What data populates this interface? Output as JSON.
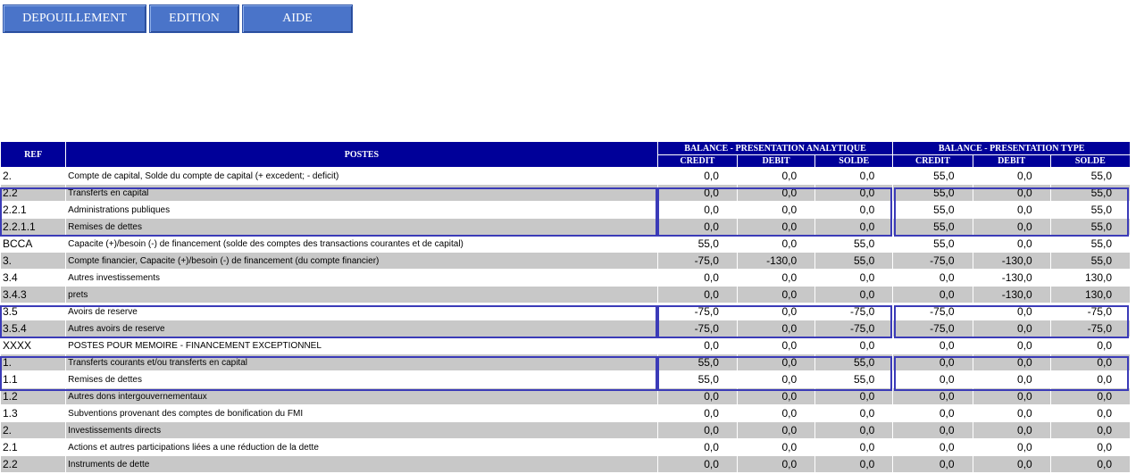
{
  "menu": {
    "depouillement": "DEPOUILLEMENT",
    "edition": "EDITION",
    "aide": "AIDE"
  },
  "table": {
    "headers": {
      "ref": "REF",
      "postes": "POSTES",
      "group_analytique": "BALANCE - PRESENTATION ANALYTIQUE",
      "group_type": "BALANCE - PRESENTATION TYPE",
      "credit": "CREDIT",
      "debit": "DEBIT",
      "solde": "SOLDE"
    },
    "rows": [
      {
        "ref": "2.",
        "label": "Compte de capital, Solde du compte de capital (+ excedent; - deficit)",
        "a": [
          "0,0",
          "0,0",
          "0,0"
        ],
        "t": [
          "55,0",
          "0,0",
          "55,0"
        ],
        "shade": false
      },
      {
        "ref": "2.2",
        "label": "Transferts en capital",
        "a": [
          "0,0",
          "0,0",
          "0,0"
        ],
        "t": [
          "55,0",
          "0,0",
          "55,0"
        ],
        "shade": true
      },
      {
        "ref": "2.2.1",
        "label": "Administrations publiques",
        "a": [
          "0,0",
          "0,0",
          "0,0"
        ],
        "t": [
          "55,0",
          "0,0",
          "55,0"
        ],
        "shade": false
      },
      {
        "ref": "2.2.1.1",
        "label": "Remises de dettes",
        "a": [
          "0,0",
          "0,0",
          "0,0"
        ],
        "t": [
          "55,0",
          "0,0",
          "55,0"
        ],
        "shade": true
      },
      {
        "ref": "BCCA",
        "label": "Capacite (+)/besoin (-) de financement (solde des comptes des transactions courantes et de capital)",
        "a": [
          "55,0",
          "0,0",
          "55,0"
        ],
        "t": [
          "55,0",
          "0,0",
          "55,0"
        ],
        "shade": false
      },
      {
        "ref": "3.",
        "label": "Compte financier, Capacite (+)/besoin (-) de financement (du compte financier)",
        "a": [
          "-75,0",
          "-130,0",
          "55,0"
        ],
        "t": [
          "-75,0",
          "-130,0",
          "55,0"
        ],
        "shade": true
      },
      {
        "ref": "3.4",
        "label": "Autres investissements",
        "a": [
          "0,0",
          "0,0",
          "0,0"
        ],
        "t": [
          "0,0",
          "-130,0",
          "130,0"
        ],
        "shade": false
      },
      {
        "ref": "3.4.3",
        "label": "prets",
        "a": [
          "0,0",
          "0,0",
          "0,0"
        ],
        "t": [
          "0,0",
          "-130,0",
          "130,0"
        ],
        "shade": true
      },
      {
        "ref": "3.5",
        "label": "Avoirs de reserve",
        "a": [
          "-75,0",
          "0,0",
          "-75,0"
        ],
        "t": [
          "-75,0",
          "0,0",
          "-75,0"
        ],
        "shade": false
      },
      {
        "ref": "3.5.4",
        "label": "Autres avoirs de reserve",
        "a": [
          "-75,0",
          "0,0",
          "-75,0"
        ],
        "t": [
          "-75,0",
          "0,0",
          "-75,0"
        ],
        "shade": true
      },
      {
        "ref": "XXXX",
        "label": "POSTES POUR MEMOIRE - FINANCEMENT EXCEPTIONNEL",
        "a": [
          "0,0",
          "0,0",
          "0,0"
        ],
        "t": [
          "0,0",
          "0,0",
          "0,0"
        ],
        "shade": false
      },
      {
        "ref": "1.",
        "label": "Transferts courants et/ou transferts en capital",
        "a": [
          "55,0",
          "0,0",
          "55,0"
        ],
        "t": [
          "0,0",
          "0,0",
          "0,0"
        ],
        "shade": true
      },
      {
        "ref": "1.1",
        "label": "Remises de dettes",
        "a": [
          "55,0",
          "0,0",
          "55,0"
        ],
        "t": [
          "0,0",
          "0,0",
          "0,0"
        ],
        "shade": false
      },
      {
        "ref": "1.2",
        "label": "Autres dons intergouvernementaux",
        "a": [
          "0,0",
          "0,0",
          "0,0"
        ],
        "t": [
          "0,0",
          "0,0",
          "0,0"
        ],
        "shade": true
      },
      {
        "ref": "1.3",
        "label": "Subventions provenant des comptes de bonification du FMI",
        "a": [
          "0,0",
          "0,0",
          "0,0"
        ],
        "t": [
          "0,0",
          "0,0",
          "0,0"
        ],
        "shade": false
      },
      {
        "ref": "2.",
        "label": "Investissements directs",
        "a": [
          "0,0",
          "0,0",
          "0,0"
        ],
        "t": [
          "0,0",
          "0,0",
          "0,0"
        ],
        "shade": true
      },
      {
        "ref": "2.1",
        "label": "Actions et autres participations liées a une réduction de la dette",
        "a": [
          "0,0",
          "0,0",
          "0,0"
        ],
        "t": [
          "0,0",
          "0,0",
          "0,0"
        ],
        "shade": false
      },
      {
        "ref": "2.2",
        "label": "Instruments de dette",
        "a": [
          "0,0",
          "0,0",
          "0,0"
        ],
        "t": [
          "0,0",
          "0,0",
          "0,0"
        ],
        "shade": true
      }
    ]
  },
  "colors": {
    "menu_bg": "#4a74c9",
    "header_bg": "#000099",
    "row_shade": "#c8c8c8",
    "highlight_border": "#3b3bb8"
  }
}
